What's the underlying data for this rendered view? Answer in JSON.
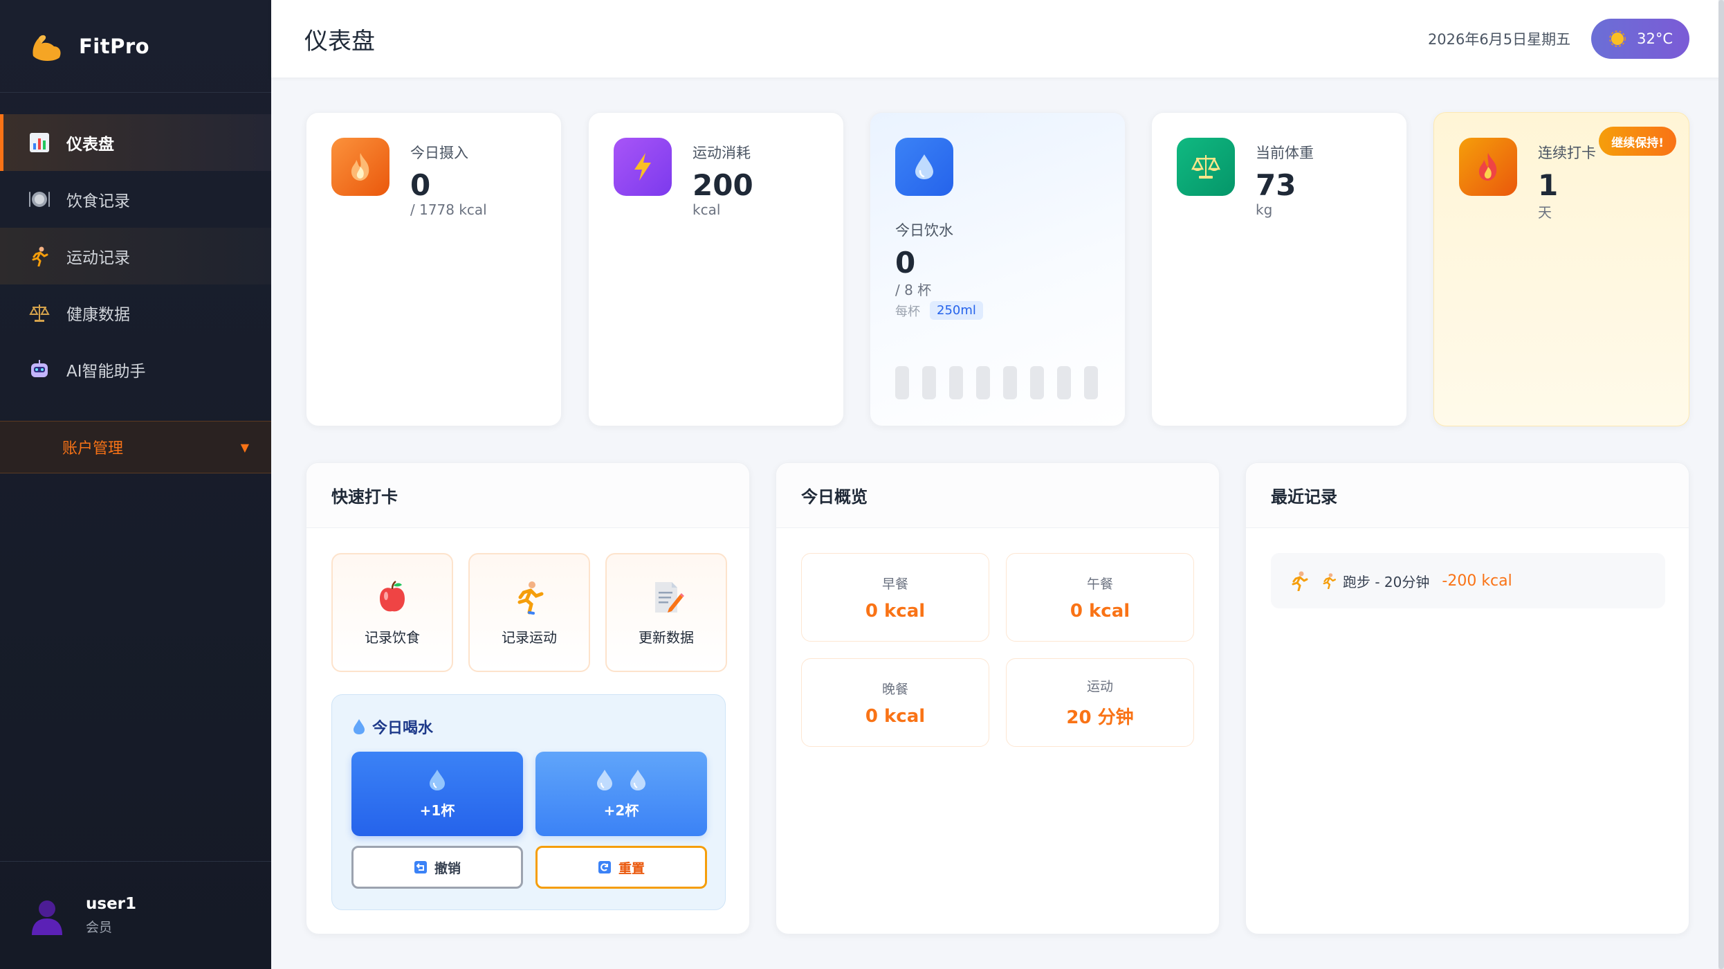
{
  "app": {
    "name": "FitPro"
  },
  "sidebar": {
    "items": [
      {
        "label": "仪表盘",
        "icon": "bar-chart-icon"
      },
      {
        "label": "饮食记录",
        "icon": "plate-icon"
      },
      {
        "label": "运动记录",
        "icon": "runner-icon"
      },
      {
        "label": "健康数据",
        "icon": "scale-icon"
      },
      {
        "label": "AI智能助手",
        "icon": "robot-icon"
      }
    ],
    "account_label": "账户管理",
    "user": {
      "name": "user1",
      "role": "会员"
    }
  },
  "header": {
    "title": "仪表盘",
    "date": "2026年6月5日星期五",
    "temperature": "32°C"
  },
  "stats": {
    "intake": {
      "label": "今日摄入",
      "value": "0",
      "unit": "/ 1778 kcal"
    },
    "burn": {
      "label": "运动消耗",
      "value": "200",
      "unit": "kcal"
    },
    "water": {
      "label": "今日饮水",
      "value": "0",
      "unit": "/ 8 杯",
      "per_cup_label": "每杯",
      "per_cup_value": "250ml",
      "cups_filled": 0,
      "cups_total": 8
    },
    "weight": {
      "label": "当前体重",
      "value": "73",
      "unit": "kg"
    },
    "streak": {
      "label": "连续打卡",
      "value": "1",
      "unit": "天",
      "badge": "继续保持!"
    }
  },
  "quick": {
    "title": "快速打卡",
    "buttons": [
      {
        "label": "记录饮食",
        "icon": "apple-icon"
      },
      {
        "label": "记录运动",
        "icon": "runner-icon"
      },
      {
        "label": "更新数据",
        "icon": "memo-icon"
      }
    ],
    "water": {
      "title": "今日喝水",
      "add1": "+1杯",
      "add2": "+2杯",
      "undo": "撤销",
      "reset": "重置"
    }
  },
  "overview": {
    "title": "今日概览",
    "cells": [
      {
        "label": "早餐",
        "value": "0 kcal"
      },
      {
        "label": "午餐",
        "value": "0 kcal"
      },
      {
        "label": "晚餐",
        "value": "0 kcal"
      },
      {
        "label": "运动",
        "value": "20 分钟"
      }
    ]
  },
  "recent": {
    "title": "最近记录",
    "items": [
      {
        "text": "跑步 - 20分钟",
        "kcal": "-200 kcal"
      }
    ]
  },
  "colors": {
    "accent": "#f97316",
    "sidebar": "#1a1f2e",
    "primary_blue": "#2563eb"
  }
}
